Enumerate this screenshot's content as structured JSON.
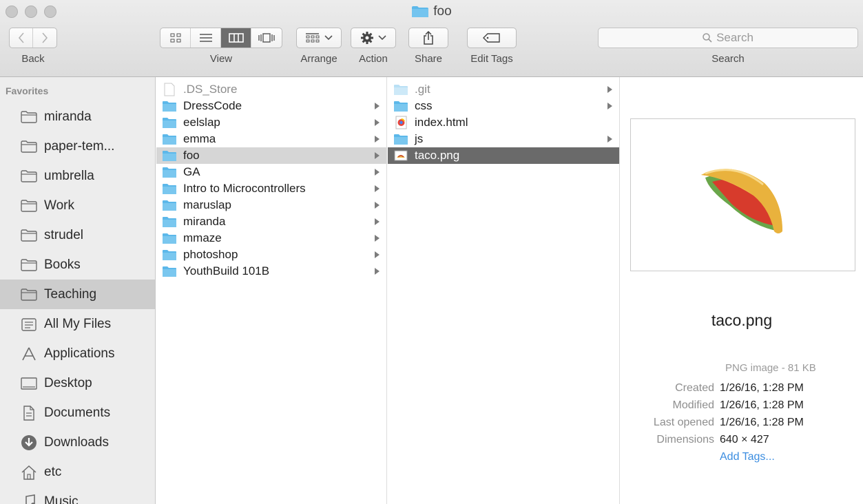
{
  "window": {
    "title": "foo"
  },
  "toolbar": {
    "back_label": "Back",
    "view_label": "View",
    "arrange_label": "Arrange",
    "action_label": "Action",
    "share_label": "Share",
    "edit_tags_label": "Edit Tags",
    "search_label": "Search",
    "search_placeholder": "Search"
  },
  "sidebar": {
    "heading": "Favorites",
    "items": [
      {
        "label": "miranda",
        "icon": "folder-icon",
        "selected": false
      },
      {
        "label": "paper-tem...",
        "icon": "folder-icon",
        "selected": false
      },
      {
        "label": "umbrella",
        "icon": "folder-icon",
        "selected": false
      },
      {
        "label": "Work",
        "icon": "folder-icon",
        "selected": false
      },
      {
        "label": "strudel",
        "icon": "folder-icon",
        "selected": false
      },
      {
        "label": "Books",
        "icon": "folder-icon",
        "selected": false
      },
      {
        "label": "Teaching",
        "icon": "folder-icon",
        "selected": true
      },
      {
        "label": "All My Files",
        "icon": "all-files-icon",
        "selected": false
      },
      {
        "label": "Applications",
        "icon": "applications-icon",
        "selected": false
      },
      {
        "label": "Desktop",
        "icon": "desktop-icon",
        "selected": false
      },
      {
        "label": "Documents",
        "icon": "documents-icon",
        "selected": false
      },
      {
        "label": "Downloads",
        "icon": "downloads-icon",
        "selected": false
      },
      {
        "label": "etc",
        "icon": "home-icon",
        "selected": false
      },
      {
        "label": "Music",
        "icon": "music-icon",
        "selected": false
      }
    ]
  },
  "column1": {
    "items": [
      {
        "name": ".DS_Store",
        "type": "file",
        "hidden": true,
        "has_children": false,
        "state": ""
      },
      {
        "name": "DressCode",
        "type": "folder",
        "has_children": true,
        "state": ""
      },
      {
        "name": "eelslap",
        "type": "folder",
        "has_children": true,
        "state": ""
      },
      {
        "name": "emma",
        "type": "folder",
        "has_children": true,
        "state": ""
      },
      {
        "name": "foo",
        "type": "folder",
        "has_children": true,
        "state": "sel-gray"
      },
      {
        "name": "GA",
        "type": "folder",
        "has_children": true,
        "state": ""
      },
      {
        "name": "Intro to Microcontrollers",
        "type": "folder",
        "has_children": true,
        "state": ""
      },
      {
        "name": "maruslap",
        "type": "folder",
        "has_children": true,
        "state": ""
      },
      {
        "name": "miranda",
        "type": "folder",
        "has_children": true,
        "state": ""
      },
      {
        "name": "mmaze",
        "type": "folder",
        "has_children": true,
        "state": ""
      },
      {
        "name": "photoshop",
        "type": "folder",
        "has_children": true,
        "state": ""
      },
      {
        "name": "YouthBuild 101B",
        "type": "folder",
        "has_children": true,
        "state": ""
      }
    ]
  },
  "column2": {
    "items": [
      {
        "name": ".git",
        "type": "folder",
        "hidden": true,
        "has_children": true,
        "state": ""
      },
      {
        "name": "css",
        "type": "folder",
        "has_children": true,
        "state": ""
      },
      {
        "name": "index.html",
        "type": "html",
        "has_children": false,
        "state": ""
      },
      {
        "name": "js",
        "type": "folder",
        "has_children": true,
        "state": ""
      },
      {
        "name": "taco.png",
        "type": "image",
        "has_children": false,
        "state": "sel-dark"
      }
    ]
  },
  "preview": {
    "file_name": "taco.png",
    "kind_size": "PNG image - 81 KB",
    "meta": [
      {
        "key": "Created",
        "value": "1/26/16, 1:28 PM"
      },
      {
        "key": "Modified",
        "value": "1/26/16, 1:28 PM"
      },
      {
        "key": "Last opened",
        "value": "1/26/16, 1:28 PM"
      },
      {
        "key": "Dimensions",
        "value": "640 × 427"
      }
    ],
    "add_tags": "Add Tags..."
  },
  "colors": {
    "folder": "#5cb8ea",
    "selection_dark": "#6a6a6a",
    "selection_gray": "#d6d6d6",
    "link": "#3b8de0"
  }
}
